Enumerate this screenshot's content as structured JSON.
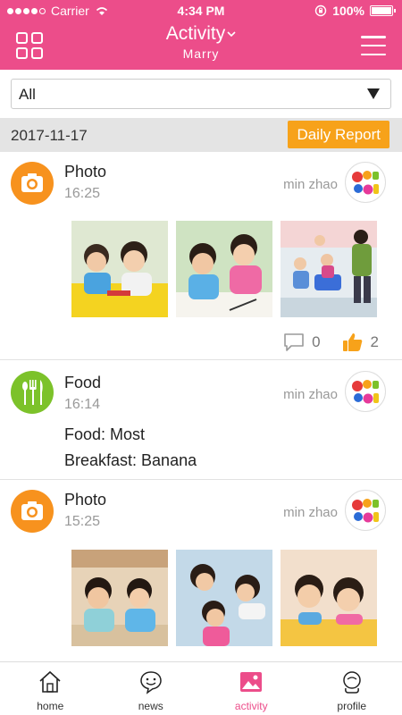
{
  "status": {
    "carrier": "Carrier",
    "time": "4:34 PM",
    "battery": "100%"
  },
  "nav": {
    "title": "Activity",
    "subtitle": "Marry"
  },
  "filter": {
    "selected": "All"
  },
  "datebar": {
    "date": "2017-11-17",
    "report_label": "Daily Report"
  },
  "feed": [
    {
      "category": "Photo",
      "time": "16:25",
      "author": "min zhao",
      "comments": "0",
      "likes": "2"
    },
    {
      "category": "Food",
      "time": "16:14",
      "author": "min zhao",
      "lines": [
        "Food: Most",
        "Breakfast: Banana"
      ]
    },
    {
      "category": "Photo",
      "time": "15:25",
      "author": "min zhao"
    }
  ],
  "tabs": [
    {
      "label": "home"
    },
    {
      "label": "news"
    },
    {
      "label": "activity"
    },
    {
      "label": "profile"
    }
  ],
  "colors": {
    "brand": "#ec4d8a",
    "accent": "#f7a21a",
    "photo_icon": "#f7921e",
    "food_icon": "#7cc22a",
    "like": "#f7a21a"
  }
}
